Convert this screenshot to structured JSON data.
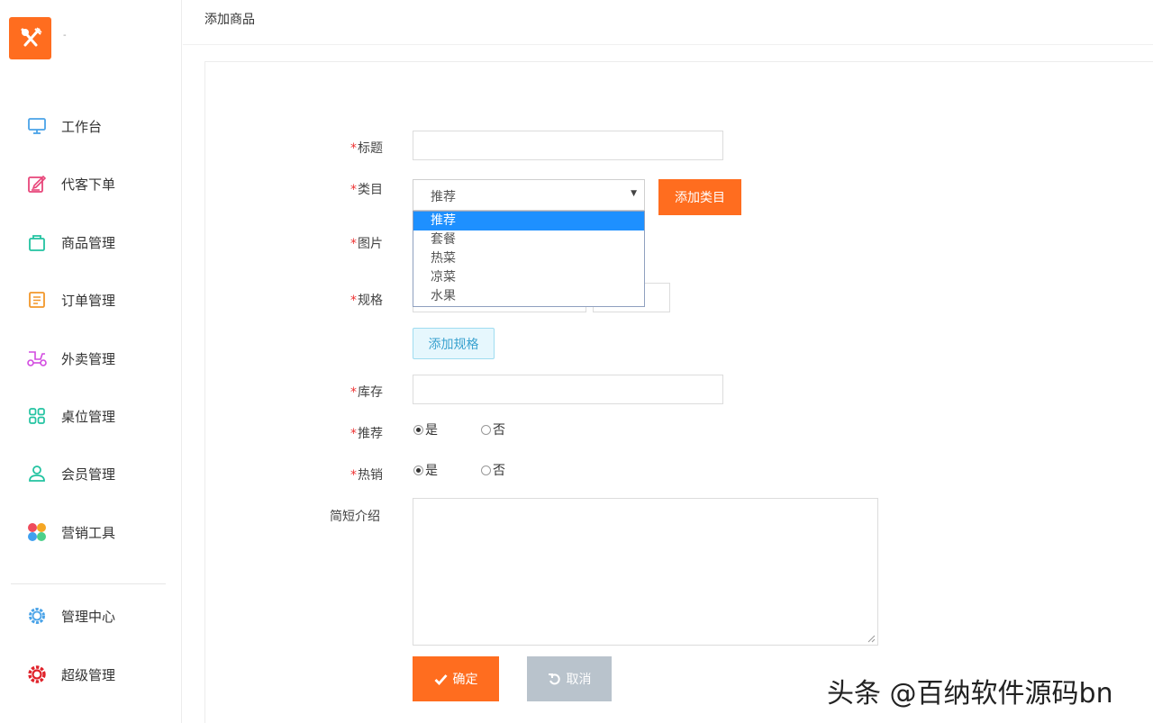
{
  "page": {
    "title": "添加商品"
  },
  "sidebar": {
    "logo_dash": "-",
    "items": [
      {
        "label": "工作台",
        "icon": "monitor-icon"
      },
      {
        "label": "代客下单",
        "icon": "edit-icon"
      },
      {
        "label": "商品管理",
        "icon": "bag-icon"
      },
      {
        "label": "订单管理",
        "icon": "list-icon"
      },
      {
        "label": "外卖管理",
        "icon": "scooter-icon"
      },
      {
        "label": "桌位管理",
        "icon": "grid-icon"
      },
      {
        "label": "会员管理",
        "icon": "user-icon"
      },
      {
        "label": "营销工具",
        "icon": "petals-icon"
      },
      {
        "label": "管理中心",
        "icon": "gear-icon"
      },
      {
        "label": "超级管理",
        "icon": "cog-icon"
      }
    ]
  },
  "form": {
    "title_label": "标题",
    "category_label": "类目",
    "category_value": "推荐",
    "category_options": [
      "推荐",
      "套餐",
      "热菜",
      "凉菜",
      "水果"
    ],
    "add_category_label": "添加类目",
    "image_label": "图片",
    "spec_label": "规格",
    "add_spec_label": "添加规格",
    "stock_label": "库存",
    "recommend_label": "推荐",
    "hot_label": "热销",
    "yes": "是",
    "no": "否",
    "intro_label": "简短介绍",
    "required_mark": "*",
    "confirm_label": "确定",
    "cancel_label": "取消"
  },
  "watermark": "头条 @百纳软件源码bn",
  "colors": {
    "accent": "#ff6d1f",
    "select_highlight": "#1e90ff",
    "cancel": "#b9c3cc"
  }
}
